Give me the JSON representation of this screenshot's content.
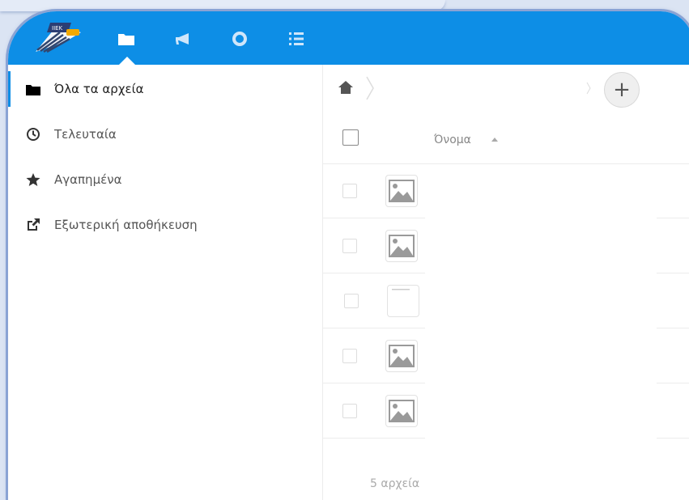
{
  "colors": {
    "header": "#0d8ee6",
    "accent": "#0d8ee6"
  },
  "header": {
    "nav": [
      {
        "icon": "folder-icon",
        "active": true
      },
      {
        "icon": "megaphone-icon",
        "active": false
      },
      {
        "icon": "circle-o-icon",
        "active": false
      },
      {
        "icon": "list-icon",
        "active": false
      }
    ]
  },
  "sidebar": {
    "items": [
      {
        "icon": "folder-icon",
        "label": "Όλα τα αρχεία",
        "active": true
      },
      {
        "icon": "clock-icon",
        "label": "Τελευταία",
        "active": false
      },
      {
        "icon": "star-icon",
        "label": "Αγαπημένα",
        "active": false
      },
      {
        "icon": "external-link-icon",
        "label": "Εξωτερική αποθήκευση",
        "active": false
      }
    ]
  },
  "main": {
    "add_label": "+",
    "columns": {
      "name": "Όνομα"
    },
    "rows": [
      {
        "icon": "image-icon"
      },
      {
        "icon": "image-icon"
      },
      {
        "icon": "file-icon"
      },
      {
        "icon": "image-icon"
      },
      {
        "icon": "image-icon"
      }
    ],
    "footer": {
      "count": "5 αρχεία"
    }
  }
}
